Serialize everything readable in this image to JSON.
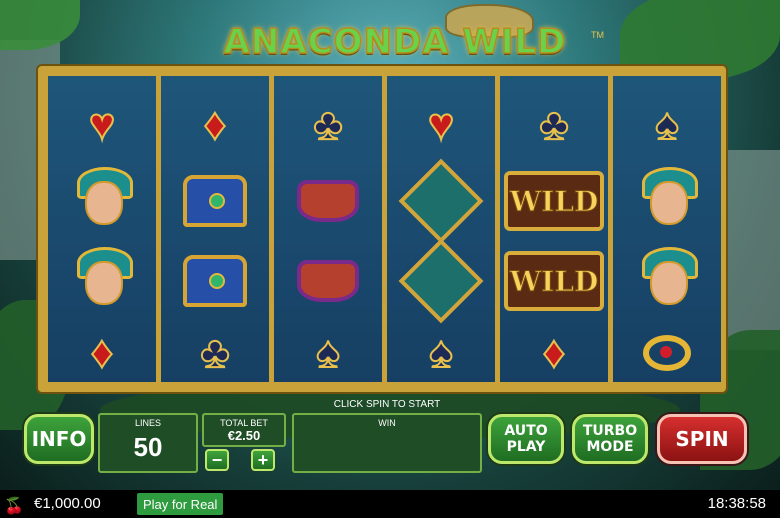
{
  "game": {
    "title": "ANACONDA WILD",
    "trademark": "TM"
  },
  "reels": [
    [
      "heart-suit",
      "queen",
      "queen",
      "diamond-suit"
    ],
    [
      "diamond-suit",
      "treasure-chest",
      "treasure-chest",
      "club-suit"
    ],
    [
      "club-suit",
      "bowl",
      "bowl",
      "spade-suit"
    ],
    [
      "heart-suit",
      "medallion",
      "medallion",
      "spade-suit"
    ],
    [
      "club-suit",
      "wild",
      "wild",
      "diamond-suit"
    ],
    [
      "spade-suit",
      "queen",
      "queen",
      "ring"
    ]
  ],
  "symbols": {
    "wild_text": "WILD"
  },
  "message": "CLICK SPIN TO START",
  "controls": {
    "info": "INFO",
    "lines_label": "LINES",
    "lines_value": "50",
    "total_bet_label": "TOTAL BET",
    "total_bet_value": "€2.50",
    "minus": "−",
    "plus": "+",
    "win_label": "WIN",
    "autoplay_line1": "AUTO",
    "autoplay_line2": "PLAY",
    "turbo_line1": "TURBO",
    "turbo_line2": "MODE",
    "spin": "SPIN"
  },
  "statusbar": {
    "balance": "€1,000.00",
    "play_for_real": "Play for Real",
    "clock": "18:38:58"
  },
  "colors": {
    "accent_gold": "#c9a23a",
    "button_green": "#2e9b3e",
    "spin_red": "#c62828",
    "reel_bg": "#1e567a"
  }
}
